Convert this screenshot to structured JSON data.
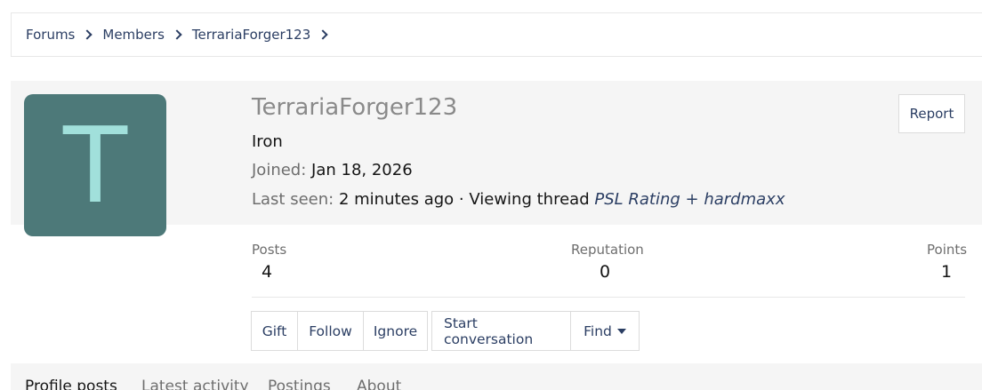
{
  "breadcrumb": {
    "items": [
      "Forums",
      "Members",
      "TerrariaForger123"
    ]
  },
  "profile": {
    "avatar_letter": "T",
    "avatar_bg": "#4d7979",
    "avatar_fg": "#a1e0db",
    "username": "TerrariaForger123",
    "rank": "Iron",
    "joined_label": "Joined:",
    "joined_value": "Jan 18, 2026",
    "last_seen_label": "Last seen:",
    "last_seen_value": "2 minutes ago · Viewing thread",
    "last_seen_thread": "PSL Rating + hardmaxx",
    "report_label": "Report"
  },
  "stats": {
    "posts_label": "Posts",
    "posts_value": "4",
    "reputation_label": "Reputation",
    "reputation_value": "0",
    "points_label": "Points",
    "points_value": "1"
  },
  "actions": {
    "gift": "Gift",
    "follow": "Follow",
    "ignore": "Ignore",
    "start_conversation": "Start conversation",
    "find": "Find"
  },
  "tabs": [
    "Profile posts",
    "Latest activity",
    "Postings",
    "About"
  ],
  "colors": {
    "link": "#2b3e63",
    "muted": "#6e6e6e",
    "panel": "#f5f5f5"
  }
}
